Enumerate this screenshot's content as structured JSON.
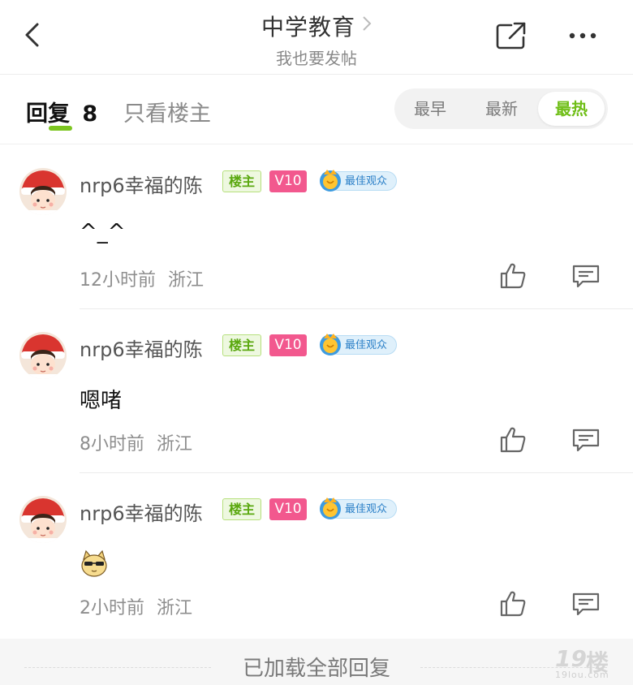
{
  "header": {
    "title": "中学教育",
    "subtitle": "我也要发帖"
  },
  "tabs": {
    "reply_label": "回复",
    "reply_count": "8",
    "owner_only_label": "只看楼主",
    "sort_options": [
      "最早",
      "最新",
      "最热"
    ],
    "sort_selected": "最热"
  },
  "comments": [
    {
      "username": "nrp6幸福的陈",
      "owner_badge": "楼主",
      "level_badge": "V10",
      "best_badge": "最佳观众",
      "content": "^_^",
      "time": "12小时前",
      "location": "浙江"
    },
    {
      "username": "nrp6幸福的陈",
      "owner_badge": "楼主",
      "level_badge": "V10",
      "best_badge": "最佳观众",
      "content": "嗯啫",
      "time": "8小时前",
      "location": "浙江"
    },
    {
      "username": "nrp6幸福的陈",
      "owner_badge": "楼主",
      "level_badge": "V10",
      "best_badge": "最佳观众",
      "content": "",
      "content_emoji": "cool-cat-sunglasses-emoji",
      "time": "2小时前",
      "location": "浙江"
    }
  ],
  "footer": {
    "loaded_text": "已加载全部回复"
  },
  "watermark": {
    "number": "19",
    "char": "楼",
    "url": "19lou.com"
  },
  "colors": {
    "accent_green": "#7cc520",
    "level_pink": "#f2588e",
    "best_blue": "#2a7fc7"
  },
  "icons": [
    "back-arrow-icon",
    "chevron-right-icon",
    "share-icon",
    "more-dots-icon",
    "thumbs-up-icon",
    "comment-icon",
    "medal-icon"
  ]
}
